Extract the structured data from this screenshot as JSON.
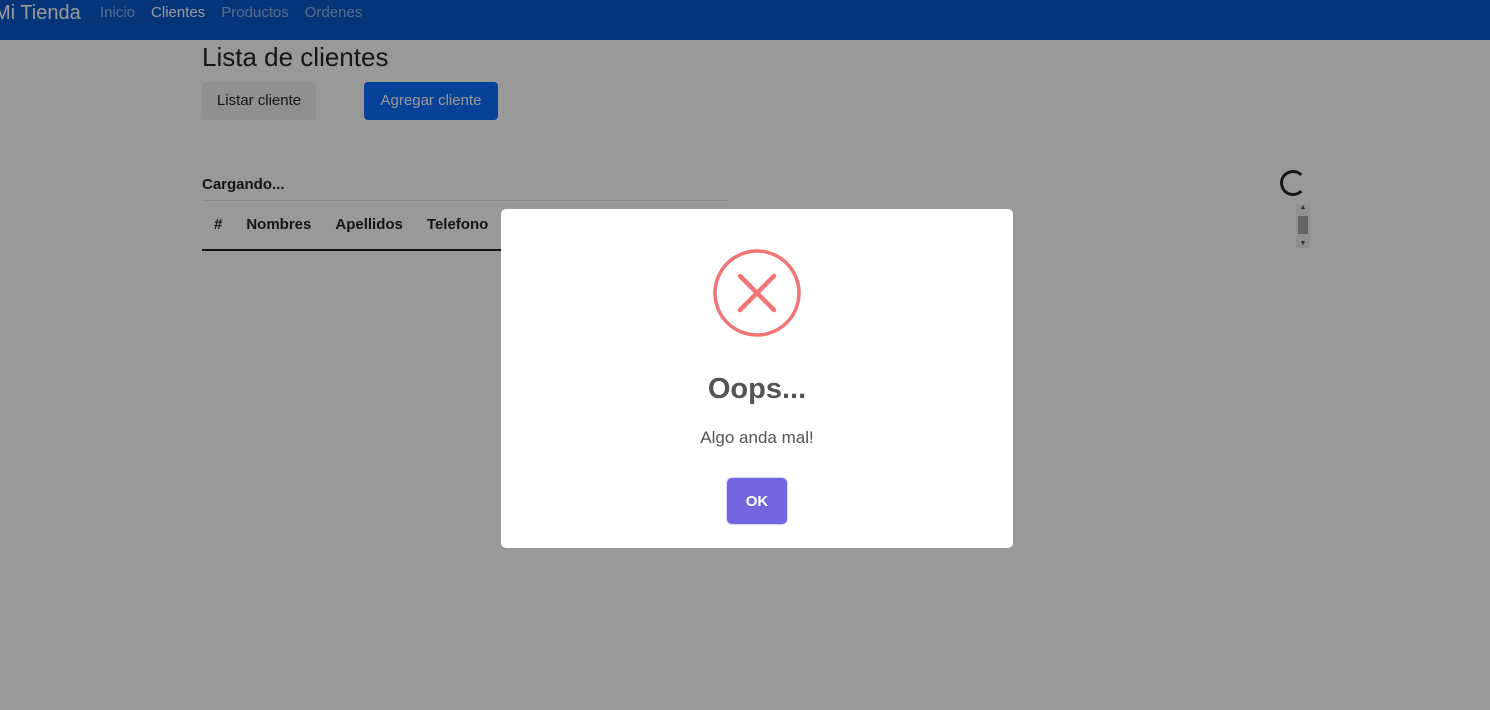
{
  "navbar": {
    "brand": "Mi Tienda",
    "links": [
      {
        "label": "Inicio",
        "active": false
      },
      {
        "label": "Clientes",
        "active": true
      },
      {
        "label": "Productos",
        "active": false
      },
      {
        "label": "Ordenes",
        "active": false
      }
    ],
    "background_color": "#0a58ca"
  },
  "main": {
    "title": "Lista de clientes",
    "buttons": {
      "list_label": "Listar cliente",
      "add_label": "Agregar cliente"
    },
    "loading_text": "Cargando...",
    "table": {
      "headers": [
        "#",
        "Nombres",
        "Apellidos",
        "Telefono"
      ]
    }
  },
  "dialog": {
    "icon": "error-x-icon",
    "icon_color": "#f27474",
    "title": "Oops...",
    "text": "Algo anda mal!",
    "confirm_label": "OK",
    "confirm_color": "#7066e0"
  }
}
